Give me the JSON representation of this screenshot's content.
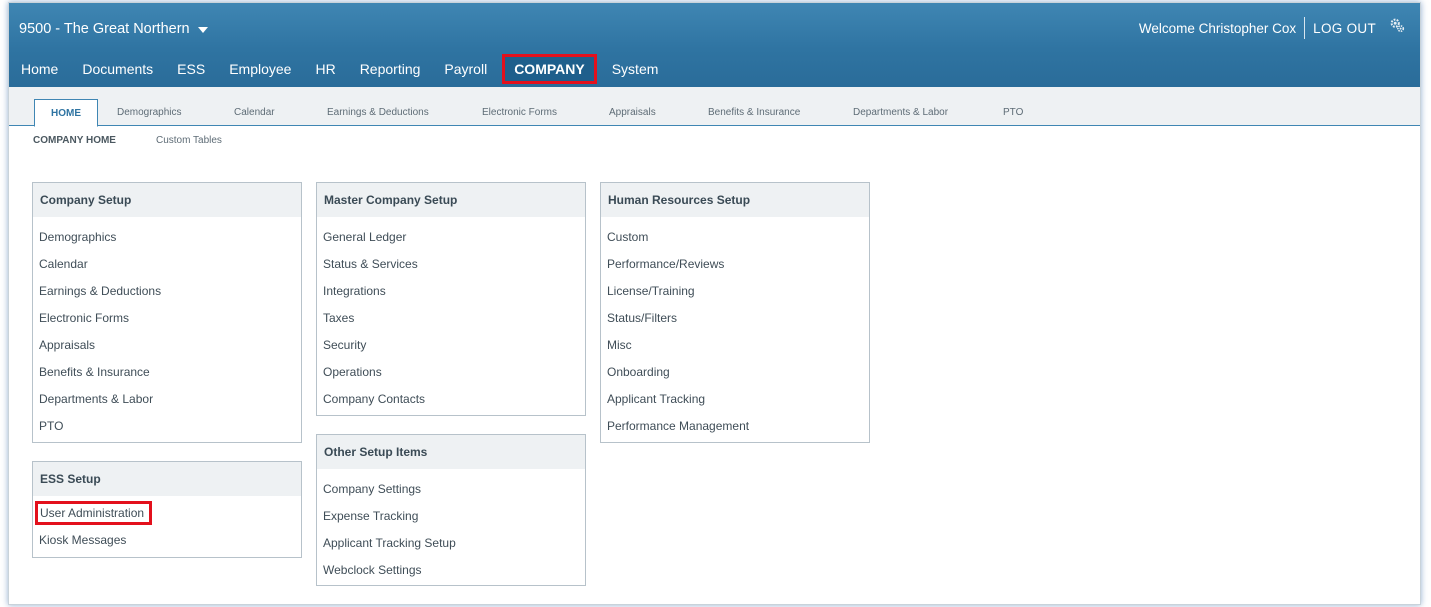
{
  "header": {
    "company_name": "9500 - The Great Northern",
    "welcome_text": "Welcome Christopher Cox",
    "logout_label": "LOG OUT"
  },
  "main_nav": {
    "items": [
      {
        "label": "Home"
      },
      {
        "label": "Documents"
      },
      {
        "label": "ESS"
      },
      {
        "label": "Employee"
      },
      {
        "label": "HR"
      },
      {
        "label": "Reporting"
      },
      {
        "label": "Payroll"
      },
      {
        "label": "COMPANY",
        "active": true
      },
      {
        "label": "System"
      }
    ]
  },
  "tabs": {
    "items": [
      {
        "label": "HOME",
        "active": true
      },
      {
        "label": "Demographics"
      },
      {
        "label": "Calendar"
      },
      {
        "label": "Earnings & Deductions"
      },
      {
        "label": "Electronic Forms"
      },
      {
        "label": "Appraisals"
      },
      {
        "label": "Benefits & Insurance"
      },
      {
        "label": "Departments & Labor"
      },
      {
        "label": "PTO"
      }
    ]
  },
  "subtabs": {
    "company_home": "COMPANY HOME",
    "custom_tables": "Custom Tables"
  },
  "panels": {
    "company_setup": {
      "title": "Company Setup",
      "items": [
        "Demographics",
        "Calendar",
        "Earnings & Deductions",
        "Electronic Forms",
        "Appraisals",
        "Benefits & Insurance",
        "Departments & Labor",
        "PTO"
      ]
    },
    "ess_setup": {
      "title": "ESS Setup",
      "items": [
        "User Administration",
        "Kiosk Messages"
      ]
    },
    "master_company_setup": {
      "title": "Master Company Setup",
      "items": [
        "General Ledger",
        "Status & Services",
        "Integrations",
        "Taxes",
        "Security",
        "Operations",
        "Company Contacts"
      ]
    },
    "other_setup_items": {
      "title": "Other Setup Items",
      "items": [
        "Company Settings",
        "Expense Tracking",
        "Applicant Tracking Setup",
        "Webclock Settings"
      ]
    },
    "human_resources_setup": {
      "title": "Human Resources Setup",
      "items": [
        "Custom",
        "Performance/Reviews",
        "License/Training",
        "Status/Filters",
        "Misc",
        "Onboarding",
        "Applicant Tracking",
        "Performance Management"
      ]
    }
  },
  "colors": {
    "header_blue": "#2f74a2",
    "highlight_red": "#e3101c",
    "panel_header_bg": "#eef1f3"
  }
}
